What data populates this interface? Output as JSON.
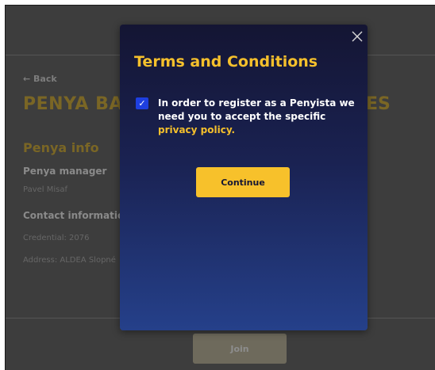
{
  "background_page": {
    "back_label": "← Back",
    "title_left": "PENYA BAR",
    "title_right": "ES",
    "section_title": "Penya info",
    "manager_label": "Penya manager",
    "manager_value": "Pavel Misaf",
    "contact_label": "Contact information",
    "credential": "Credential: 2076",
    "address": "Address: ALDEA Slopné",
    "join_label": "Join"
  },
  "modal": {
    "title": "Terms and Conditions",
    "checkbox_checked": true,
    "checkbox_glyph": "✓",
    "consent_text": "In order to register as a Penyista we need you to accept the specific ",
    "privacy_link": "privacy policy.",
    "continue_label": "Continue"
  },
  "colors": {
    "accent": "#f5c02c",
    "checkbox": "#1e3fe0",
    "modal_top": "#141533",
    "modal_bottom": "#25408a"
  }
}
